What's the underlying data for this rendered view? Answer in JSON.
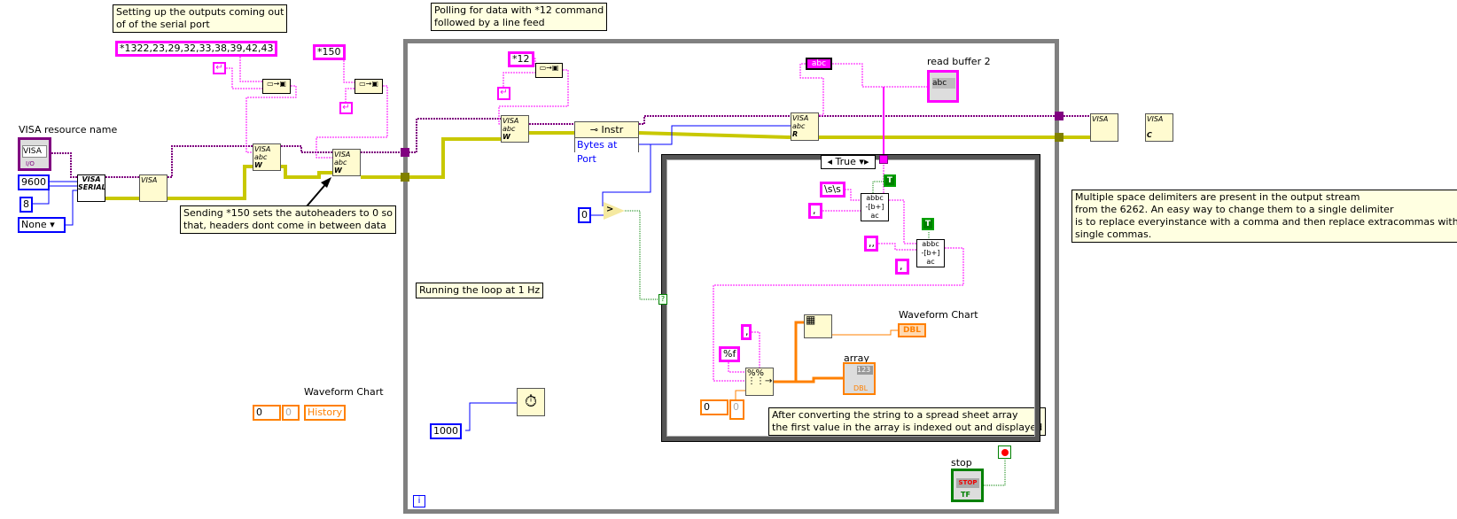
{
  "comments": {
    "setup": "Setting up the outputs coming out\nof of the serial port",
    "polling": "Polling for data with *12 command\nfollowed by a line feed",
    "autoheaders": "Sending *150 sets the autoheaders to 0 so\nthat, headers dont come in between data",
    "loop_rate": "Running the loop at 1 Hz",
    "spreadsheet": "After converting the string to a spread sheet array\nthe first value in the array is indexed out and displayed",
    "delimiters": "Multiple space delimiters are present in the output stream\nfrom the 6262. An easy way to change them to a single delimiter\nis to replace everyinstance with a comma and then replace extracommas with\nsingle commas."
  },
  "constants": {
    "outputs_cmd": "*1322,23,29,32,33,38,39,42,43",
    "autoheader_cmd": "*150",
    "poll_cmd": "*12",
    "baud_rate": "9600",
    "data_bits": "8",
    "parity": "None",
    "zero": "0",
    "wait_ms": "1000",
    "double_space": "\\s\\s",
    "comma1": ",",
    "comma2": ",,",
    "comma3": ",",
    "comma4": ",",
    "format": "%f",
    "index": "0",
    "index_out": "0",
    "true1": "T",
    "true2": "T",
    "empty_string": "abc"
  },
  "controls": {
    "visa_resource_label": "VISA resource name",
    "visa_resource_value": "VISA",
    "visa_resource_type": "I/O",
    "read_buffer_label": "read buffer 2",
    "read_buffer_value": "abc",
    "waveform_chart_label": "Waveform Chart",
    "waveform_chart_type": "DBL",
    "array_label": "array",
    "array_type": "DBL",
    "array_value": "123",
    "history_label": "Waveform Chart",
    "history_value": "History",
    "history_index": "0",
    "history_value_num": "0",
    "stop_label": "stop",
    "stop_button": "STOP",
    "stop_type": "TF"
  },
  "nodes": {
    "visa_serial": "VISA SERIAL",
    "visa": "VISA",
    "write_mode": "W",
    "read_mode": "R",
    "abc": "abc",
    "property_class": "Instr",
    "property_name": "Bytes at Port",
    "case_selector": "True",
    "replace_icon": "abbc\n-[b+]\nac",
    "iteration": "i",
    "close_mode": "C"
  },
  "colors": {
    "string_wire": "#ff00ff",
    "visa_wire": "#800080",
    "error_wire": "#c8c800",
    "int_wire": "#0000ff",
    "dbl_wire": "#ff8000",
    "bool_wire": "#008000",
    "comment_bg": "#ffffe1"
  }
}
